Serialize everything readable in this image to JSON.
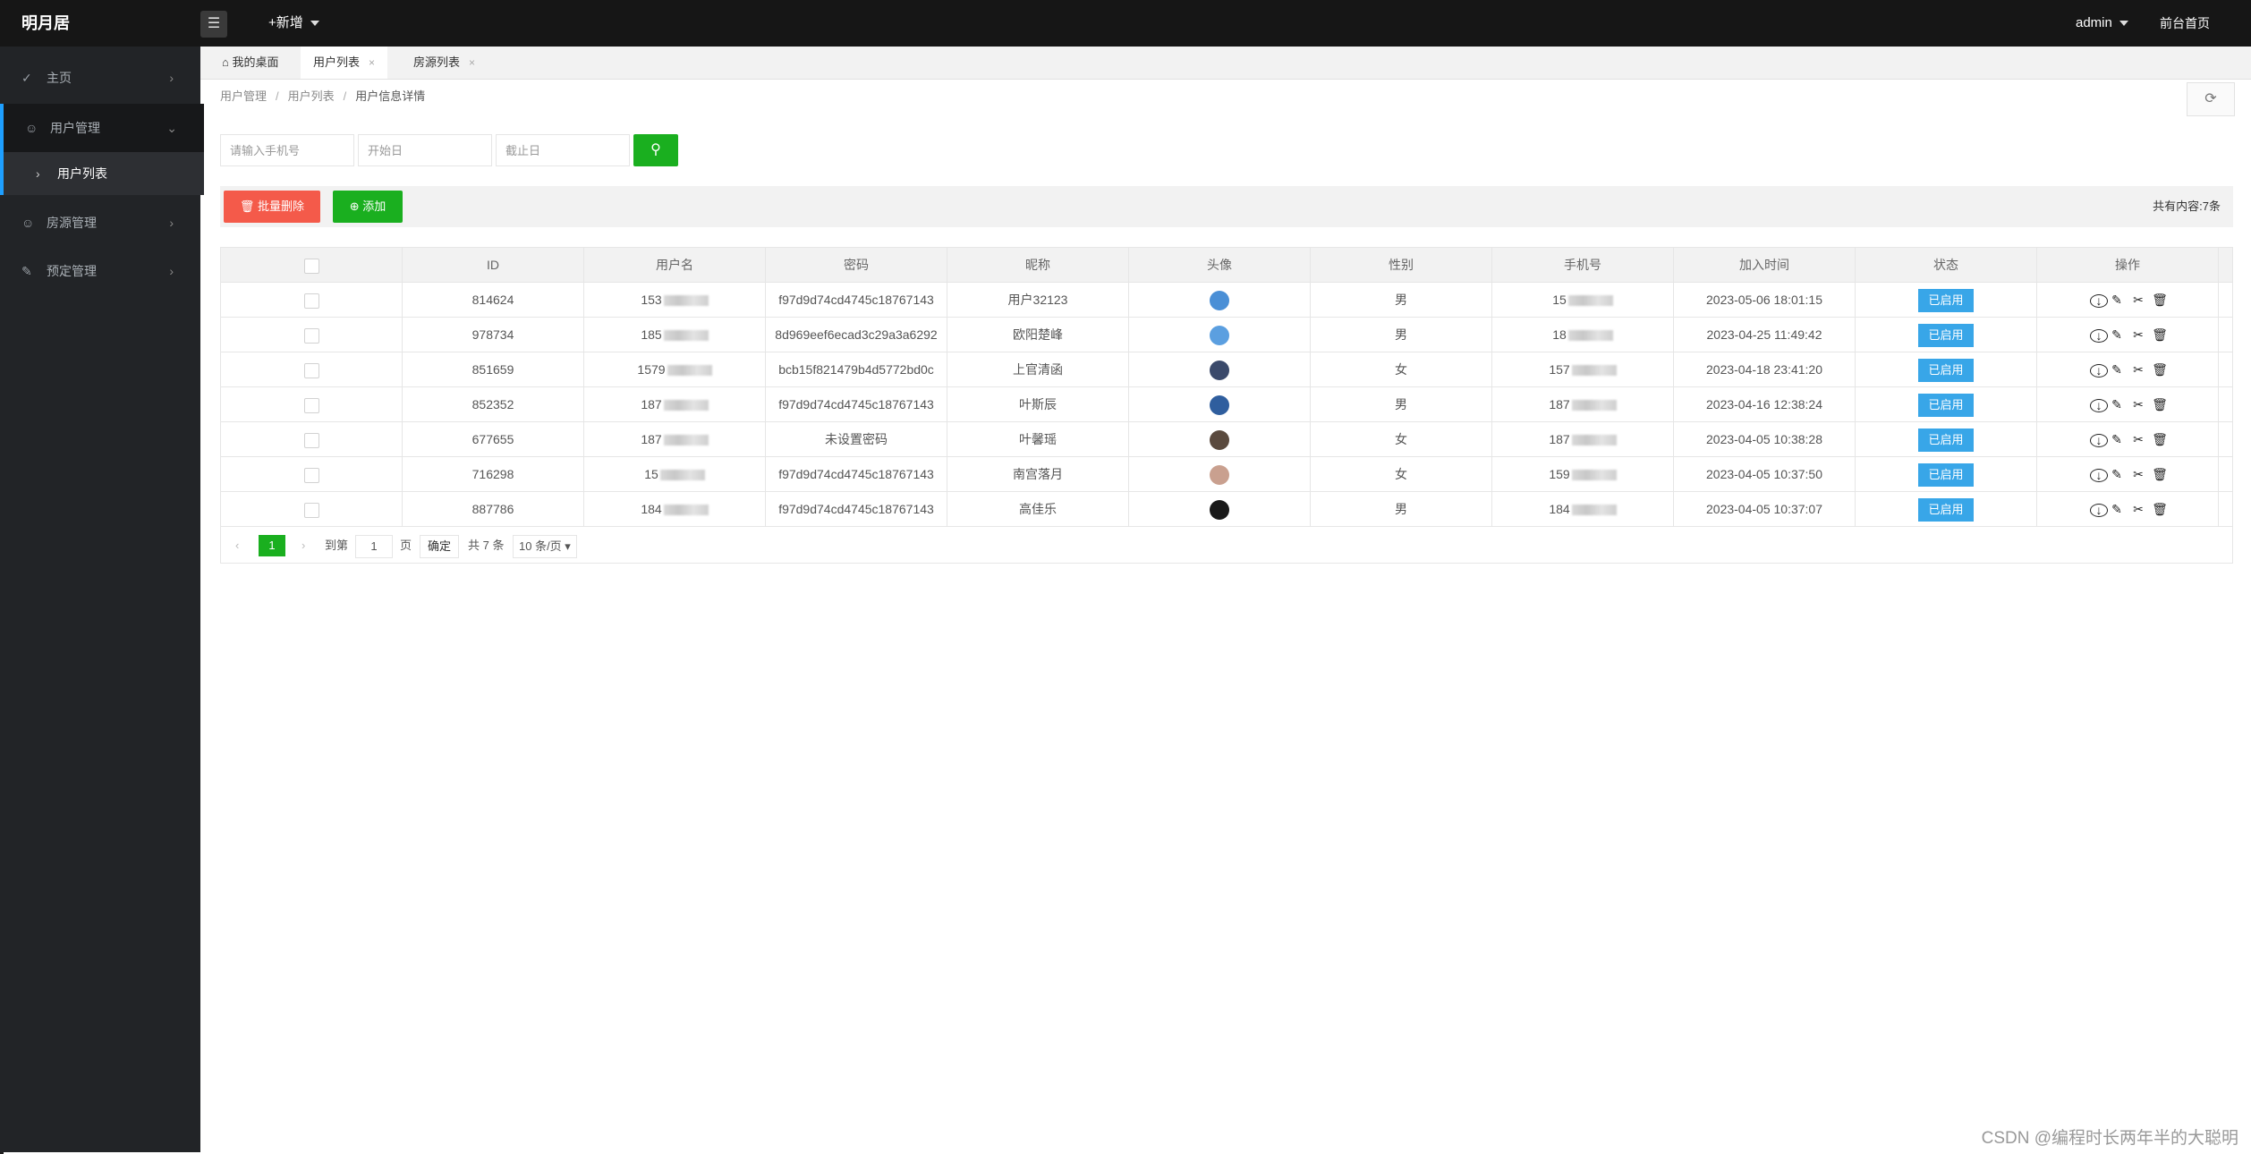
{
  "header": {
    "logo": "明月居",
    "menu_icon": "hamburger-icon",
    "new_label": "+新增",
    "user": "admin",
    "front_link": "前台首页"
  },
  "sidebar": {
    "items": [
      {
        "label": "主页",
        "icon": "home-icon"
      },
      {
        "label": "用户管理",
        "icon": "user-icon"
      },
      {
        "label": "用户列表",
        "icon": "chevron-right-icon"
      },
      {
        "label": "房源管理",
        "icon": "user-icon"
      },
      {
        "label": "预定管理",
        "icon": "booking-icon"
      }
    ]
  },
  "tabs": [
    {
      "label": "我的桌面",
      "icon": "home-icon"
    },
    {
      "label": "用户列表",
      "close": "×"
    },
    {
      "label": "房源列表",
      "close": "×"
    }
  ],
  "breadcrumb": [
    "用户管理",
    "用户列表",
    "用户信息详情"
  ],
  "search": {
    "phone_placeholder": "请输入手机号",
    "start_placeholder": "开始日",
    "end_placeholder": "截止日"
  },
  "toolbar": {
    "delete_label": "批量删除",
    "add_label": "添加",
    "total": "共有内容:7条"
  },
  "table": {
    "columns": [
      "ID",
      "用户名",
      "密码",
      "昵称",
      "头像",
      "性别",
      "手机号",
      "加入时间",
      "状态",
      "操作"
    ],
    "rows": [
      {
        "id": "814624",
        "user": "153",
        "pwd": "f97d9d74cd4745c18767143",
        "nick": "用户32123",
        "gender": "男",
        "phone": "15",
        "time": "2023-05-06 18:01:15",
        "status": "已启用",
        "avatar": "#4a8fd6"
      },
      {
        "id": "978734",
        "user": "185",
        "pwd": "8d969eef6ecad3c29a3a6292",
        "nick": "欧阳楚峰",
        "gender": "男",
        "phone": "18",
        "time": "2023-04-25 11:49:42",
        "status": "已启用",
        "avatar": "#5b9fe0"
      },
      {
        "id": "851659",
        "user": "1579",
        "pwd": "bcb15f821479b4d5772bd0c",
        "nick": "上官清函",
        "gender": "女",
        "phone": "157",
        "time": "2023-04-18 23:41:20",
        "status": "已启用",
        "avatar": "#3b4a6b"
      },
      {
        "id": "852352",
        "user": "187",
        "pwd": "f97d9d74cd4745c18767143",
        "nick": "叶斯辰",
        "gender": "男",
        "phone": "187",
        "time": "2023-04-16 12:38:24",
        "status": "已启用",
        "avatar": "#2f5e9e"
      },
      {
        "id": "677655",
        "user": "187",
        "pwd": "未设置密码",
        "nick": "叶馨瑶",
        "gender": "女",
        "phone": "187",
        "time": "2023-04-05 10:38:28",
        "status": "已启用",
        "avatar": "#5a4a3e"
      },
      {
        "id": "716298",
        "user": "15",
        "pwd": "f97d9d74cd4745c18767143",
        "nick": "南宫落月",
        "gender": "女",
        "phone": "159",
        "time": "2023-04-05 10:37:50",
        "status": "已启用",
        "avatar": "#c9a08f"
      },
      {
        "id": "887786",
        "user": "184",
        "pwd": "f97d9d74cd4745c18767143",
        "nick": "高佳乐",
        "gender": "男",
        "phone": "184",
        "time": "2023-04-05 10:37:07",
        "status": "已启用",
        "avatar": "#1a1a1a"
      }
    ]
  },
  "pager": {
    "current": "1",
    "goto_label": "到第",
    "page_input": "1",
    "page_label": "页",
    "ok_label": "确定",
    "total_label": "共 7 条",
    "size_label": "10 条/页"
  },
  "watermark": "CSDN @编程时长两年半的大聪明",
  "colors": {
    "accent_green": "#1aaf1f",
    "danger": "#f45a4a",
    "status_blue": "#38a6e8",
    "sidebar_bg": "#222427"
  }
}
